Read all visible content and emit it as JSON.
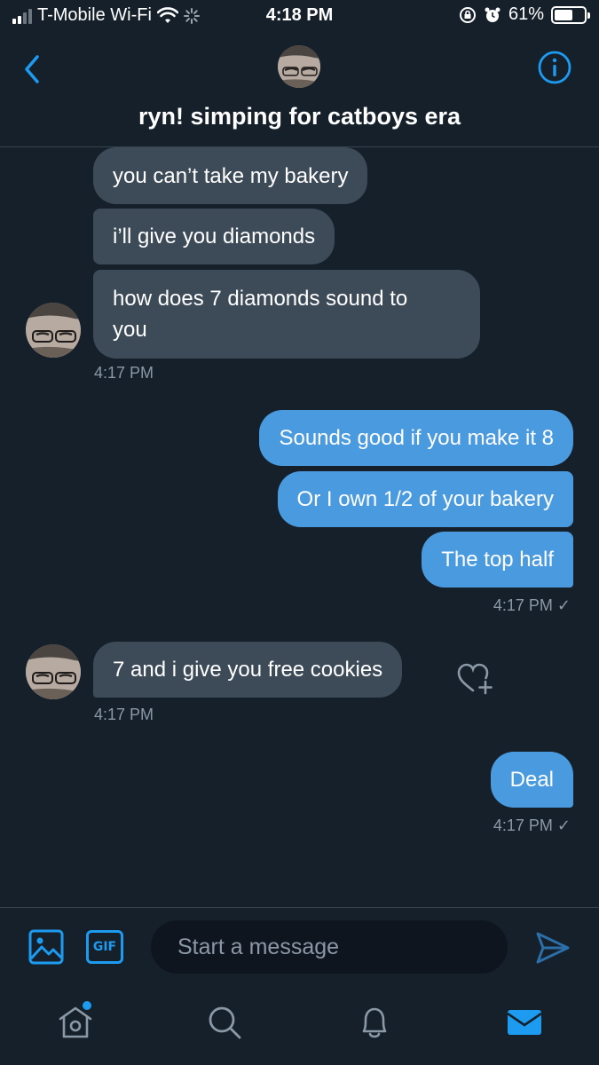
{
  "status_bar": {
    "carrier": "T-Mobile Wi-Fi",
    "time": "4:18 PM",
    "battery": "61%",
    "battery_level": 0.61
  },
  "header": {
    "title": "ryn! simping for catboys era"
  },
  "messages": [
    {
      "side": "received",
      "text": "you can’t take my bakery"
    },
    {
      "side": "received",
      "text": "i’ll give you diamonds"
    },
    {
      "side": "received",
      "text_line1": "how does 7 diamonds sound to",
      "text_line2": "you"
    },
    {
      "side": "received",
      "timestamp": "4:17 PM"
    },
    {
      "side": "sent",
      "text": "Sounds good if you make it 8"
    },
    {
      "side": "sent",
      "text": "Or I own 1/2 of your bakery"
    },
    {
      "side": "sent",
      "text": "The top half"
    },
    {
      "side": "sent",
      "timestamp": "4:17 PM ✓"
    },
    {
      "side": "received",
      "text": "7 and i give you free cookies"
    },
    {
      "side": "received",
      "timestamp": "4:17 PM"
    },
    {
      "side": "sent",
      "text": "Deal"
    },
    {
      "side": "sent",
      "timestamp": "4:17 PM ✓"
    }
  ],
  "composer": {
    "gif_label": "GIF",
    "placeholder": "Start a message"
  },
  "icons": {
    "back": "chevron-left-icon",
    "info": "info-icon",
    "media": "image-icon",
    "gif": "gif-icon",
    "send": "send-icon",
    "react": "heart-plus-icon",
    "tabs": [
      "home-icon",
      "search-icon",
      "bell-icon",
      "mail-icon"
    ]
  },
  "colors": {
    "background": "#15202b",
    "accent": "#1d9bf0",
    "received_bubble": "#3d4b58",
    "sent_bubble": "#4a9ae0"
  }
}
